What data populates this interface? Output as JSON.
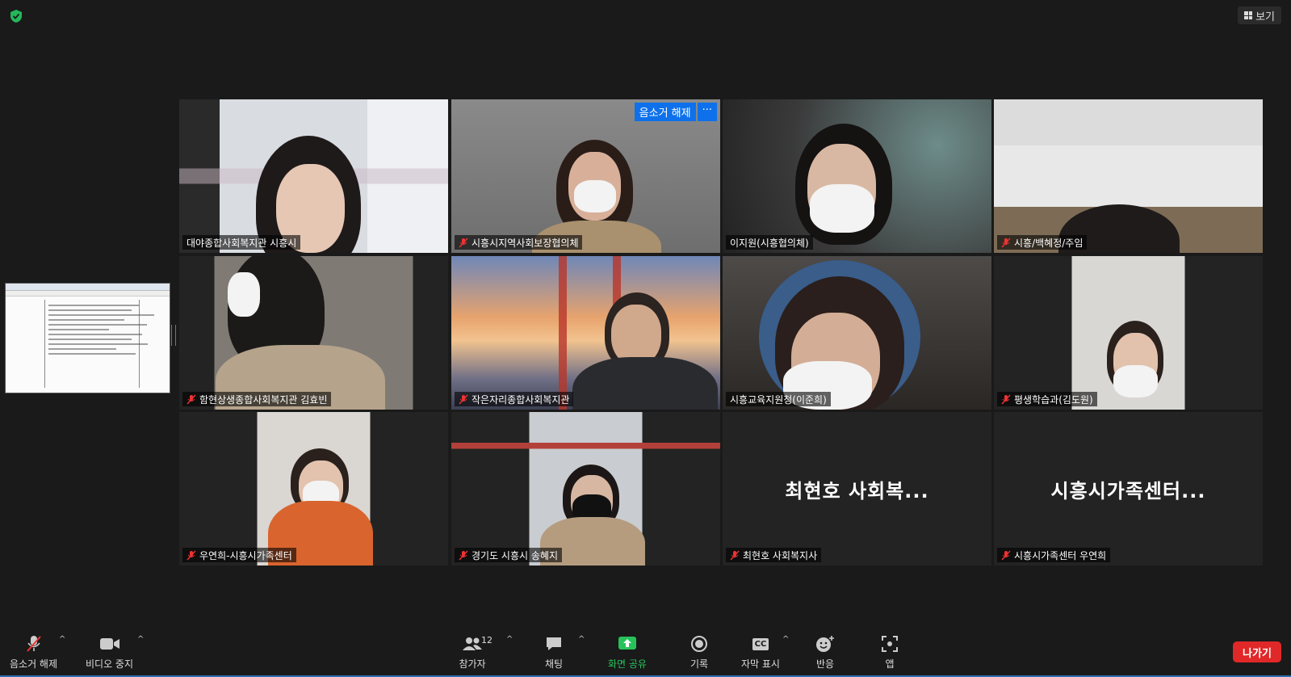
{
  "header": {
    "view_label": "보기"
  },
  "tiles": [
    {
      "name": "대야종합사회복지관 시흥시",
      "muted": false,
      "active": true,
      "video": true
    },
    {
      "name": "시흥시지역사회보장협의체",
      "muted": true,
      "video": true,
      "overlay_unmute": "음소거 해제",
      "overlay_more": "···"
    },
    {
      "name": "이지원(시흥협의체)",
      "muted": false,
      "video": true
    },
    {
      "name": "시흥/백혜정/주임",
      "muted": true,
      "video": true
    },
    {
      "name": "함현상생종합사회복지관 김효빈",
      "muted": true,
      "video": true
    },
    {
      "name": "작은자리종합사회복지관",
      "muted": true,
      "video": true
    },
    {
      "name": "시흥교육지원청(이준희)",
      "muted": false,
      "video": true
    },
    {
      "name": "평생학습과(김도원)",
      "muted": true,
      "video": true
    },
    {
      "name": "우연희-시흥시가족센터",
      "muted": true,
      "video": true
    },
    {
      "name": "경기도 시흥시 송혜지",
      "muted": true,
      "video": true
    },
    {
      "name": "최현호 사회복지사",
      "muted": true,
      "video": false,
      "display_name": "최현호 사회복..."
    },
    {
      "name": "시흥시가족센터 우연희",
      "muted": true,
      "video": false,
      "display_name": "시흥시가족센터..."
    }
  ],
  "toolbar": {
    "unmute": "음소거 해제",
    "stop_video": "비디오 중지",
    "participants": "참가자",
    "participants_count": "12",
    "chat": "채팅",
    "share_screen": "화면 공유",
    "record": "기록",
    "captions": "자막 표시",
    "captions_icon_text": "CC",
    "reactions": "반응",
    "apps": "앱",
    "leave": "나가기"
  },
  "colors": {
    "active_border": "#e8ef6e",
    "share_green": "#27c35a",
    "leave_red": "#e02828",
    "overlay_blue": "#0e71eb"
  }
}
